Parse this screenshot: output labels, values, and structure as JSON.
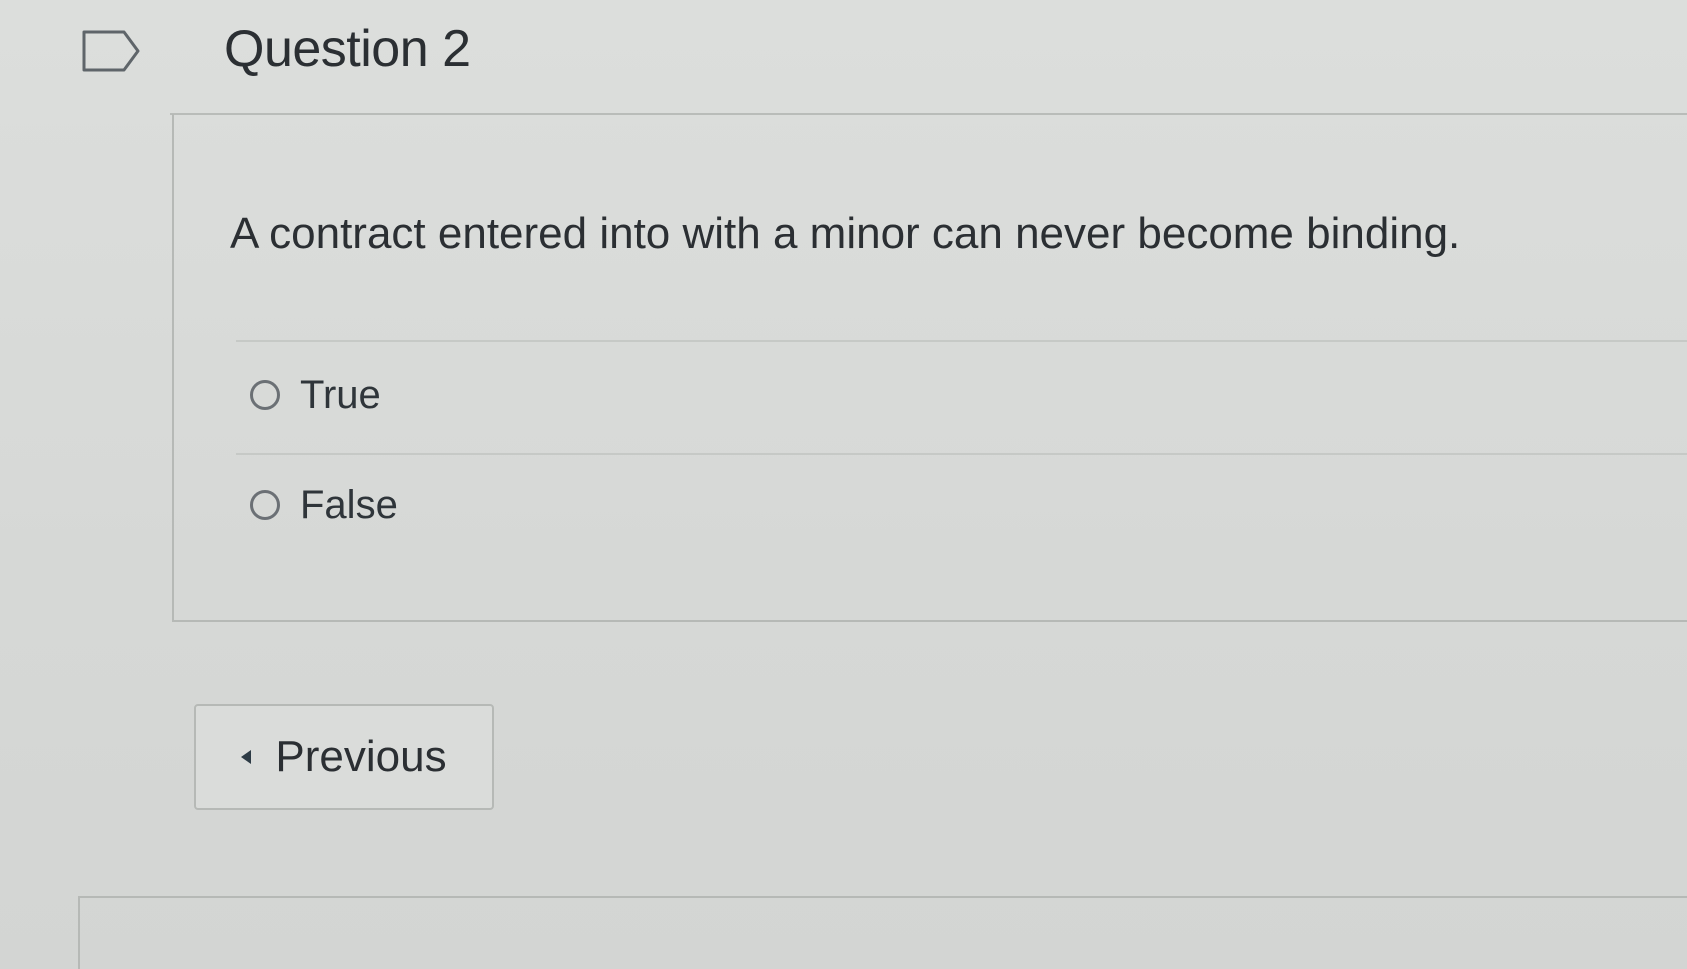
{
  "question": {
    "title": "Question 2",
    "text": "A contract entered into with a minor can never become binding.",
    "flag_icon": "flag-icon"
  },
  "answers": [
    {
      "label": "True",
      "selected": false
    },
    {
      "label": "False",
      "selected": false
    }
  ],
  "navigation": {
    "previous_label": "Previous",
    "previous_icon": "caret-left-icon"
  }
}
